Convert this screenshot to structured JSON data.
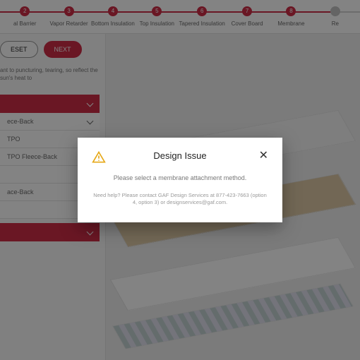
{
  "steps": [
    {
      "n": "2",
      "label": "al Barrier"
    },
    {
      "n": "3",
      "label": "Vapor Retarder"
    },
    {
      "n": "4",
      "label": "Bottom Insulation"
    },
    {
      "n": "5",
      "label": "Top Insulation"
    },
    {
      "n": "6",
      "label": "Tapered Insulation"
    },
    {
      "n": "7",
      "label": "Cover Board"
    },
    {
      "n": "8",
      "label": "Membrane"
    },
    {
      "n": "",
      "label": "Re"
    }
  ],
  "buttons": {
    "reset": "ESET",
    "next": "NEXT"
  },
  "description": "ant to puncturing, tearing, so reflect the sun's heat to",
  "side": {
    "acc1": "",
    "acc2": "",
    "items": [
      "ece-Back",
      "TPO",
      "TPO Fleece-Back",
      "",
      "ace-Back",
      ""
    ]
  },
  "modal": {
    "title": "Design Issue",
    "message": "Please select a membrane attachment method.",
    "help": "Need help? Please contact GAF Design Services at 877-423-7663 (option 4, option 3) or designservices@gaf.com."
  }
}
